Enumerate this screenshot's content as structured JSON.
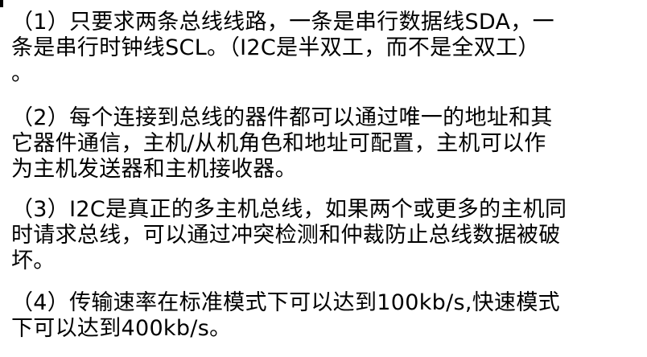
{
  "paragraphs": [
    {
      "lines": [
        "（1）只要求两条总线线路，一条是串行数据线SDA，一",
        "条是串行时钟线SCL。（I2C是半双工，而不是全双工）",
        "。"
      ]
    },
    {
      "lines": [
        "（2）每个连接到总线的器件都可以通过唯一的地址和其",
        "它器件通信，主机/从机角色和地址可配置，主机可以作",
        "为主机发送器和主机接收器。"
      ]
    },
    {
      "lines": [
        "（3）I2C是真正的多主机总线，如果两个或更多的主机同",
        "时请求总线，可以通过冲突检测和仲裁防止总线数据被破",
        "坏。"
      ]
    },
    {
      "lines": [
        "（4）传输速率在标准模式下可以达到100kb/s,快速模式",
        "下可以达到400kb/s。"
      ]
    }
  ]
}
